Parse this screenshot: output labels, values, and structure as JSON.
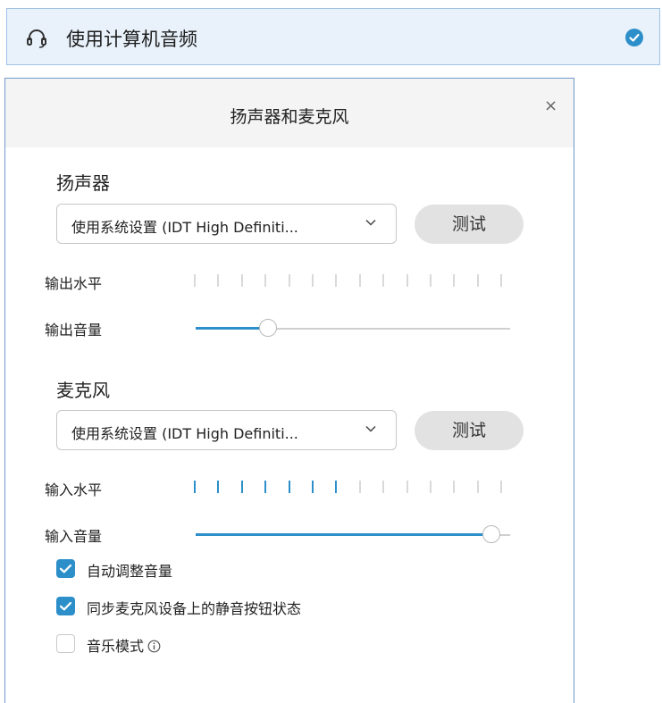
{
  "audio_option": {
    "title": "使用计算机音频",
    "icon": "headset-icon",
    "selected": true,
    "accent": "#2d8fca"
  },
  "dialog": {
    "title": "扬声器和麦克风",
    "close_glyph": "×",
    "speaker": {
      "section_label": "扬声器",
      "device": "使用系统设置 (IDT High Definiti...",
      "test_label": "测试",
      "output_level_label": "输出水平",
      "output_level_active_segments": 0,
      "output_level_total_segments": 14,
      "output_volume_label": "输出音量",
      "output_volume_fraction": 0.23
    },
    "microphone": {
      "section_label": "麦克风",
      "device": "使用系统设置 (IDT High Definiti...",
      "test_label": "测试",
      "input_level_label": "输入水平",
      "input_level_active_segments": 7,
      "input_level_total_segments": 14,
      "input_volume_label": "输入音量",
      "input_volume_fraction": 0.94
    },
    "options": [
      {
        "label": "自动调整音量",
        "checked": true
      },
      {
        "label": "同步麦克风设备上的静音按钮状态",
        "checked": true
      },
      {
        "label": "音乐模式",
        "checked": false,
        "info_icon": "info-icon"
      }
    ]
  }
}
